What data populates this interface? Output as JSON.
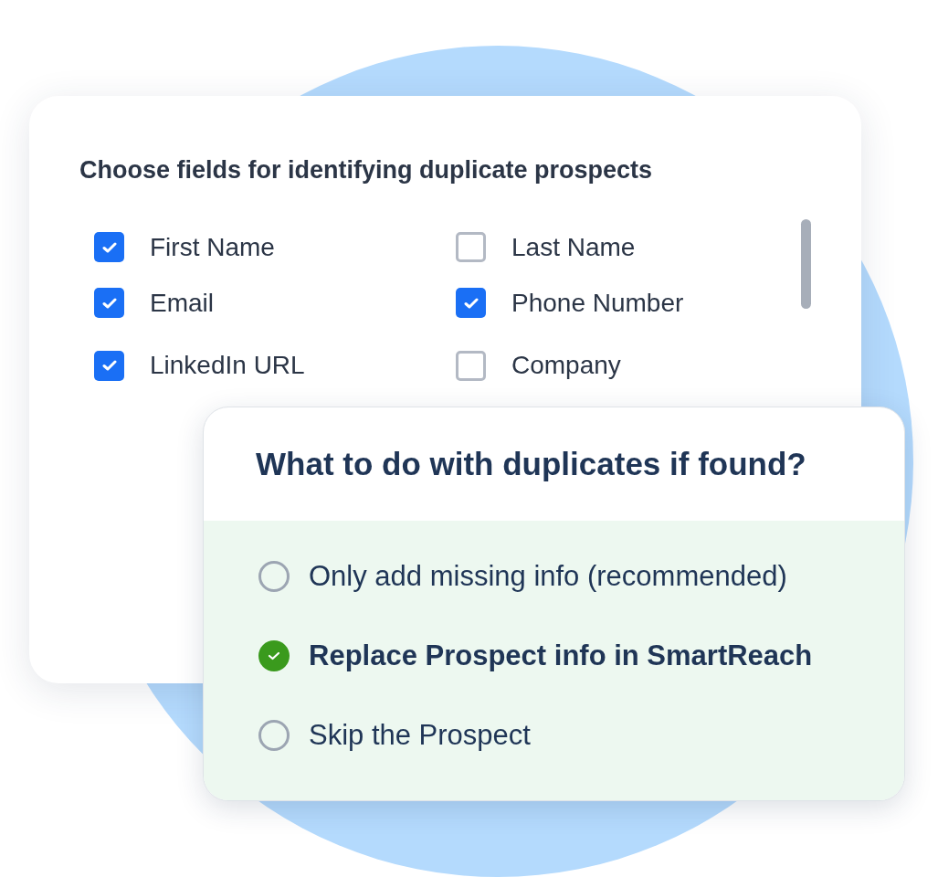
{
  "fields_card": {
    "title": "Choose fields for identifying duplicate prospects",
    "fields": [
      {
        "label": "First Name",
        "checked": true
      },
      {
        "label": "Last Name",
        "checked": false
      },
      {
        "label": "Email",
        "checked": true
      },
      {
        "label": "Phone Number",
        "checked": true
      },
      {
        "label": "LinkedIn URL",
        "checked": true
      },
      {
        "label": "Company",
        "checked": false
      }
    ]
  },
  "duplicates_card": {
    "title": "What to do with duplicates if found?",
    "options": [
      {
        "label": "Only add missing info (recommended)",
        "selected": false
      },
      {
        "label": "Replace Prospect info in SmartReach",
        "selected": true
      },
      {
        "label": "Skip the Prospect",
        "selected": false
      }
    ]
  }
}
